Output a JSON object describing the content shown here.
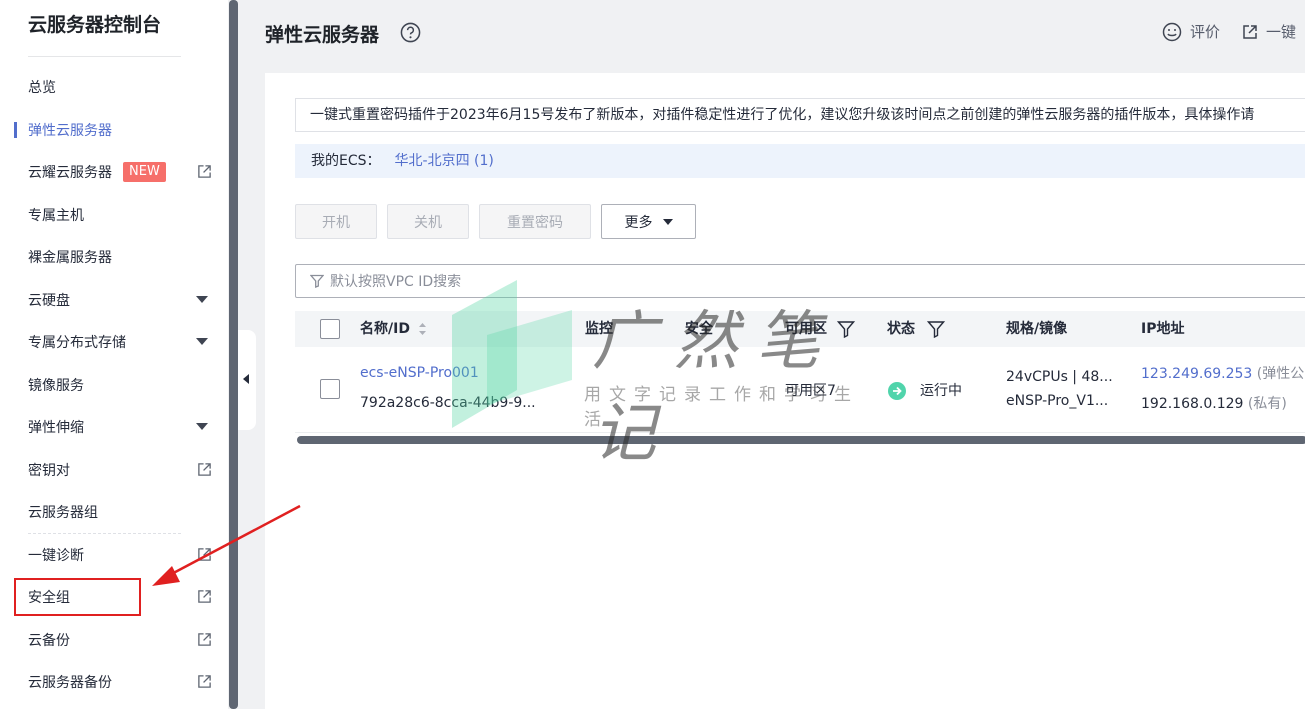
{
  "sidebar": {
    "title": "云服务器控制台",
    "items": [
      {
        "label": "总览"
      },
      {
        "label": "弹性云服务器"
      },
      {
        "label": "云耀云服务器",
        "badge": "NEW"
      },
      {
        "label": "专属主机"
      },
      {
        "label": "裸金属服务器"
      },
      {
        "label": "云硬盘"
      },
      {
        "label": "专属分布式存储"
      },
      {
        "label": "镜像服务"
      },
      {
        "label": "弹性伸缩"
      },
      {
        "label": "密钥对"
      },
      {
        "label": "云服务器组"
      },
      {
        "label": "一键诊断"
      },
      {
        "label": "安全组"
      },
      {
        "label": "云备份"
      },
      {
        "label": "云服务器备份"
      }
    ]
  },
  "header": {
    "title": "弹性云服务器",
    "feedback": "评价",
    "one_click": "一键"
  },
  "notice": "一键式重置密码插件于2023年6月15号发布了新版本，对插件稳定性进行了优化，建议您升级该时间点之前创建的弹性云服务器的插件版本，具体操作请",
  "region": {
    "label": "我的ECS：",
    "value": "华北-北京四 (1)"
  },
  "toolbar": {
    "start": "开机",
    "stop": "关机",
    "reset_password": "重置密码",
    "more": "更多"
  },
  "search": {
    "placeholder": "默认按照VPC ID搜索"
  },
  "table": {
    "headers": {
      "name": "名称/ID",
      "monitor": "监控",
      "security": "安全",
      "zone": "可用区",
      "status": "状态",
      "spec": "规格/镜像",
      "ip": "IP地址"
    },
    "rows": [
      {
        "name": "ecs-eNSP-Pro001",
        "id": "792a28c6-8cca-44b9-9...",
        "zone": "可用区7",
        "status": "运行中",
        "spec": "24vCPUs | 48...",
        "image": "eNSP-Pro_V1...",
        "ip_public": "123.249.69.253",
        "ip_public_tag": "(弹性公",
        "ip_private": "192.168.0.129",
        "ip_private_tag": "(私有)"
      }
    ]
  },
  "watermark": {
    "title": "广然笔记",
    "subtitle": "用文字记录工作和学习生活"
  },
  "colors": {
    "accent": "#526ecc",
    "status_running": "#50d4ab",
    "highlight": "#e02020"
  }
}
